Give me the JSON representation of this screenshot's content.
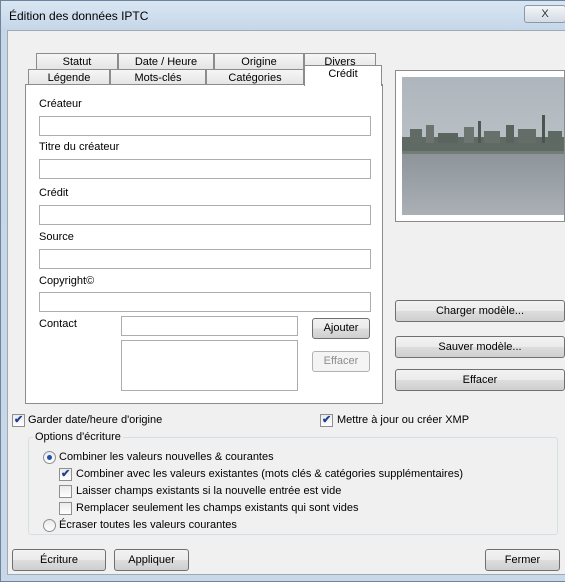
{
  "window": {
    "title": "Édition des données IPTC",
    "close_label": "X"
  },
  "tabs_row1": [
    "Statut",
    "Date / Heure",
    "Origine",
    "Divers"
  ],
  "tabs_row2": [
    "Légende",
    "Mots-clés",
    "Catégories",
    "Crédit"
  ],
  "active_tab": "Crédit",
  "fields": {
    "createur": {
      "label": "Créateur",
      "value": ""
    },
    "titre_createur": {
      "label": "Titre du créateur",
      "value": ""
    },
    "credit": {
      "label": "Crédit",
      "value": ""
    },
    "source": {
      "label": "Source",
      "value": ""
    },
    "copyright": {
      "label": "Copyright©",
      "value": ""
    },
    "contact": {
      "label": "Contact",
      "value": ""
    }
  },
  "buttons": {
    "ajouter": "Ajouter",
    "effacer_contact": "Effacer",
    "charger_modele": "Charger modèle...",
    "sauver_modele": "Sauver modèle...",
    "effacer": "Effacer",
    "ecriture": "Écriture",
    "appliquer": "Appliquer",
    "fermer": "Fermer"
  },
  "checks": {
    "garder_date": {
      "label": "Garder date/heure d'origine",
      "checked": true
    },
    "mettre_a_jour_xmp": {
      "label": "Mettre à jour ou créer XMP",
      "checked": true
    }
  },
  "options": {
    "title": "Options d'écriture",
    "combiner": {
      "label": "Combiner les valeurs nouvelles & courantes",
      "selected": true
    },
    "combiner_existantes": {
      "label": "Combiner avec les valeurs existantes (mots clés & catégories supplémentaires)",
      "checked": true
    },
    "laisser_champs": {
      "label": "Laisser champs existants si la nouvelle entrée est vide",
      "checked": false
    },
    "remplacer_vides": {
      "label": "Remplacer seulement les champs existants qui sont vides",
      "checked": false
    },
    "ecraser": {
      "label": "Écraser toutes les valeurs courantes",
      "selected": false
    }
  },
  "colors": {
    "window_frame": "#c5d6e8",
    "dialog_bg": "#f0f0f0",
    "check_mark": "#1c3f94"
  }
}
